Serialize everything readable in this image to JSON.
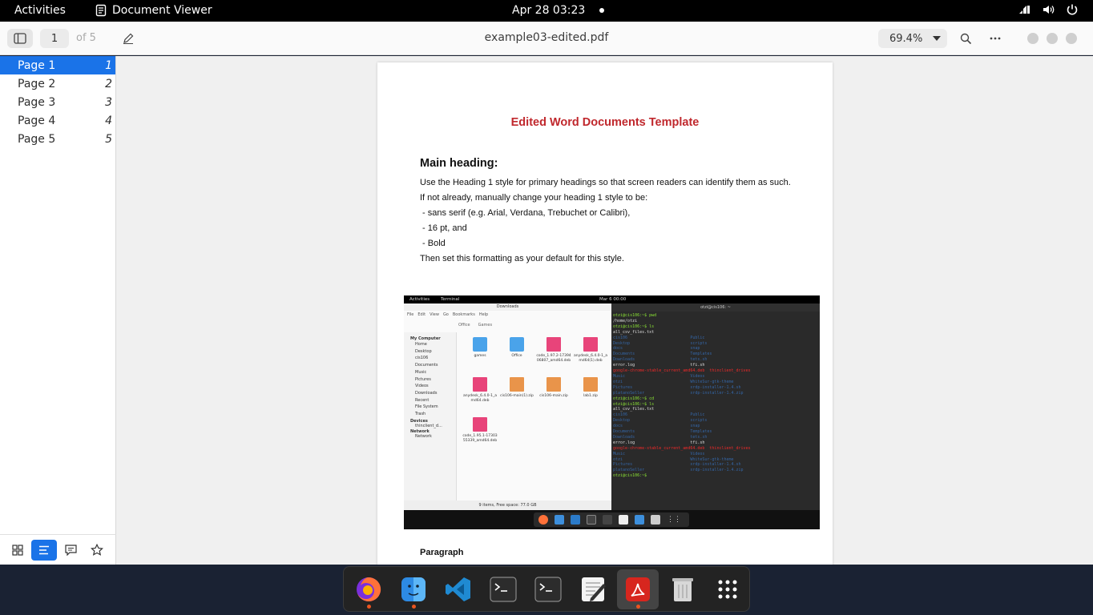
{
  "topbar": {
    "activities": "Activities",
    "app_name": "Document Viewer",
    "clock": "Apr 28  03:23"
  },
  "header": {
    "page_number": "1",
    "page_of": "of 5",
    "title": "example03-edited.pdf",
    "zoom": "69.4%"
  },
  "sidebar": {
    "items": [
      {
        "label": "Page 1",
        "num": "1"
      },
      {
        "label": "Page 2",
        "num": "2"
      },
      {
        "label": "Page 3",
        "num": "3"
      },
      {
        "label": "Page 4",
        "num": "4"
      },
      {
        "label": "Page 5",
        "num": "5"
      }
    ],
    "active_index": 0,
    "active_tab": "outline"
  },
  "document": {
    "title": "Edited Word Documents Template",
    "main_heading": "Main heading:",
    "lines": [
      "Use the Heading 1 style for primary headings so that screen readers can identify them as such.",
      "If not already, manually change your heading 1 style to be:",
      " - sans serif (e.g. Arial, Verdana, Trebuchet or Calibri),",
      " - 16 pt, and",
      " - Bold",
      "Then set this formatting as your default for this style."
    ],
    "sub_heading": "Paragraph"
  },
  "screenshot": {
    "topbar": {
      "activities": "Activities",
      "app": "Terminal",
      "clock": "Mar 6  00:00"
    },
    "files": {
      "title": "Downloads",
      "menu": [
        "File",
        "Edit",
        "View",
        "Go",
        "Bookmarks",
        "Help"
      ],
      "path": [
        "Office",
        "Games"
      ],
      "sidebar_header": "My Computer",
      "sidebar": [
        "Home",
        "Desktop",
        "cis106",
        "Documents",
        "Music",
        "Pictures",
        "Videos",
        "Downloads",
        "Recent",
        "File System",
        "Trash"
      ],
      "devices_header": "Devices",
      "devices": [
        "thinclient_d..."
      ],
      "network_header": "Network",
      "network": [
        "Network"
      ],
      "items": [
        {
          "name": "games",
          "kind": "folder"
        },
        {
          "name": "Office",
          "kind": "folder"
        },
        {
          "name": "code_1.97.2-1739406807_amd64.deb",
          "kind": "deb"
        },
        {
          "name": "anydesk_6.4.0-1_amd64(1).deb",
          "kind": "deb"
        },
        {
          "name": "anydesk_6.4.0-1_amd64.deb",
          "kind": "deb"
        },
        {
          "name": "cis106-main(1).zip",
          "kind": "zip"
        },
        {
          "name": "cis106-main.zip",
          "kind": "zip"
        },
        {
          "name": "lab1.zip",
          "kind": "zip"
        },
        {
          "name": "code_1.95.1-1730355339_amd64.deb",
          "kind": "deb"
        }
      ],
      "status": "9 items, Free space: 77.0 GB"
    },
    "terminal": {
      "title": "otzi@cis106: ~",
      "lines": [
        {
          "text": "otzi@cis106:~$ pwd",
          "color": "#8ae234"
        },
        {
          "text": "/home/otzi",
          "color": "#dddddd"
        },
        {
          "text": "otzi@cis106:~$ ls",
          "color": "#8ae234"
        },
        {
          "text": "all_csv_files.txt",
          "color": "#dddddd"
        },
        {
          "text": "cis106                          Public",
          "color": "#3465a4"
        },
        {
          "text": "Desktop                         scripts",
          "color": "#3465a4"
        },
        {
          "text": "docs                            snap",
          "color": "#3465a4"
        },
        {
          "text": "Documents                       Templates",
          "color": "#3465a4"
        },
        {
          "text": "Downloads                       tets.sh",
          "color": "#3465a4"
        },
        {
          "text": "error.log                       tfi.sh",
          "color": "#dddddd"
        },
        {
          "text": "google-chrome-stable_current_amd64.deb  thinclient_drives",
          "color": "#ef2929"
        },
        {
          "text": "Music                           Videos",
          "color": "#3465a4"
        },
        {
          "text": "otzi                            WhiteSur-gtk-theme",
          "color": "#3465a4"
        },
        {
          "text": "Pictures                        xrdp-installer-1.4.sh",
          "color": "#3465a4"
        },
        {
          "text": "platanoSeller                   xrdp-installer-1.4.zip",
          "color": "#3465a4"
        },
        {
          "text": "otzi@cis106:~$ cd",
          "color": "#8ae234"
        },
        {
          "text": "otzi@cis106:~$ ls",
          "color": "#8ae234"
        },
        {
          "text": "all_csv_files.txt",
          "color": "#dddddd"
        },
        {
          "text": "cis106                          Public",
          "color": "#3465a4"
        },
        {
          "text": "Desktop                         scripts",
          "color": "#3465a4"
        },
        {
          "text": "docs                            snap",
          "color": "#3465a4"
        },
        {
          "text": "Documents                       Templates",
          "color": "#3465a4"
        },
        {
          "text": "Downloads                       tets.sh",
          "color": "#3465a4"
        },
        {
          "text": "error.log                       tfi.sh",
          "color": "#dddddd"
        },
        {
          "text": "google-chrome-stable_current_amd64.deb  thinclient_drives",
          "color": "#ef2929"
        },
        {
          "text": "Music                           Videos",
          "color": "#3465a4"
        },
        {
          "text": "otzi                            WhiteSur-gtk-theme",
          "color": "#3465a4"
        },
        {
          "text": "Pictures                        xrdp-installer-1.4.sh",
          "color": "#3465a4"
        },
        {
          "text": "platanoSeller                   xrdp-installer-1.4.zip",
          "color": "#3465a4"
        },
        {
          "text": "otzi@cis106:~$ ",
          "color": "#8ae234"
        }
      ]
    }
  },
  "dock": {
    "items": [
      {
        "name": "firefox",
        "running": true,
        "active": false
      },
      {
        "name": "files",
        "running": true,
        "active": false
      },
      {
        "name": "vscode",
        "running": false,
        "active": false
      },
      {
        "name": "terminal",
        "running": false,
        "active": false
      },
      {
        "name": "terminal-2",
        "running": false,
        "active": false
      },
      {
        "name": "text-editor",
        "running": false,
        "active": false
      },
      {
        "name": "document-viewer",
        "running": true,
        "active": true
      },
      {
        "name": "trash",
        "running": false,
        "active": false
      },
      {
        "name": "show-apps",
        "running": false,
        "active": false
      }
    ]
  },
  "colors": {
    "accent": "#1a73e8",
    "title_red": "#c0282d",
    "running_dot": "#e95420"
  }
}
